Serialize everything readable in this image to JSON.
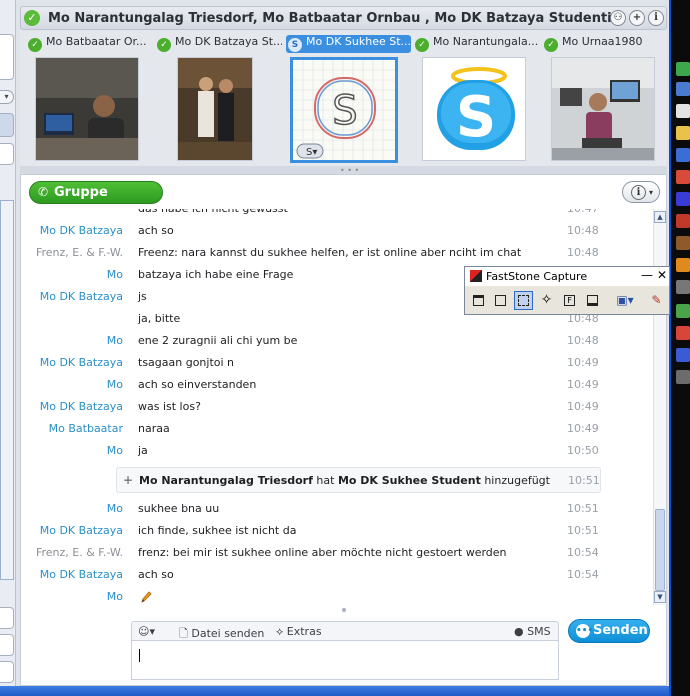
{
  "window": {
    "title": "Mo Narantungalag Triesdorf, Mo Batbaatar Ornbau , Mo DK Batzaya Studentin, ..."
  },
  "participants": [
    {
      "name": "Mo Batbaatar Or...",
      "active": false
    },
    {
      "name": "Mo DK Batzaya St...",
      "active": false
    },
    {
      "name": "Mo DK Sukhee St...",
      "active": true
    },
    {
      "name": "Mo Narantungala...",
      "active": false
    },
    {
      "name": "Mo Urnaa1980",
      "active": false
    }
  ],
  "toolbar": {
    "call_label": "Gruppe anrufen",
    "info_label": "i"
  },
  "messages": [
    {
      "sender": "",
      "text": "das habe ich nicht gewusst",
      "time": "10:47"
    },
    {
      "sender": "Mo DK Batzaya",
      "text": "ach so",
      "time": "10:48"
    },
    {
      "sender": "Frenz, E. & F.-W.",
      "text": "Freenz: nara kannst du sukhee helfen, er ist online aber nciht im chat",
      "time": "10:48"
    },
    {
      "sender": "Mo",
      "text": "batzaya ich habe eine Frage",
      "time": "10:48"
    },
    {
      "sender": "Mo DK Batzaya",
      "text": "js",
      "time": "10:48"
    },
    {
      "sender": "",
      "text": "ja, bitte",
      "time": "10:48"
    },
    {
      "sender": "Mo",
      "text": "ene 2 zuragnii ali chi yum be",
      "time": "10:48"
    },
    {
      "sender": "Mo DK Batzaya",
      "text": "tsagaan gonjtoi n",
      "time": "10:49"
    },
    {
      "sender": "Mo",
      "text": "ach so einverstanden",
      "time": "10:49"
    },
    {
      "sender": "Mo DK Batzaya",
      "text": "was ist los?",
      "time": "10:49"
    },
    {
      "sender": "Mo Batbaatar",
      "text": "naraa",
      "time": "10:49"
    },
    {
      "sender": "Mo",
      "text": "ja",
      "time": "10:50"
    }
  ],
  "system_message": {
    "actor": "Mo Narantungalag Triesdorf",
    "verb": " hat ",
    "target": "Mo DK Sukhee Student",
    "suffix": " hinzugefügt",
    "time": "10:51"
  },
  "messages_after": [
    {
      "sender": "Mo",
      "text": "sukhee bna uu",
      "time": "10:51"
    },
    {
      "sender": "Mo DK Batzaya",
      "text": "ich finde, sukhee ist nicht da",
      "time": "10:51"
    },
    {
      "sender": "Frenz, E. & F.-W.",
      "text": "frenz: bei mir ist sukhee online aber möchte nicht gestoert werden",
      "time": "10:54"
    },
    {
      "sender": "Mo DK Batzaya",
      "text": "ach so",
      "time": "10:54"
    },
    {
      "sender": "Mo",
      "text": "",
      "time": ""
    }
  ],
  "compose": {
    "emoticon_label": "☺▾",
    "file_label": "Datei senden",
    "extras_label": "Extras",
    "sms_label": "SMS",
    "send_label": "Senden"
  },
  "faststone": {
    "title": "FastStone Capture"
  },
  "colors": {
    "sender_blue": "#2a90c8",
    "sender_gray": "#8b8f96",
    "call_green": "#2d9a1f",
    "send_blue": "#0e8fd6",
    "active_tab": "#3a8fe0"
  }
}
